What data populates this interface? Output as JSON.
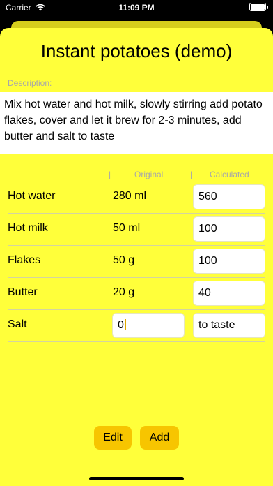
{
  "status": {
    "carrier": "Carrier",
    "time": "11:09 PM"
  },
  "title": "Instant potatoes (demo)",
  "description": {
    "label": "Description:",
    "text": "Mix hot water and hot milk, slowly stirring add potato flakes, cover and let it brew for 2-3 minutes, add butter and salt to taste"
  },
  "table": {
    "sep": "|",
    "original_header": "Original",
    "calculated_header": "Calculated",
    "rows": [
      {
        "name": "Hot water",
        "original": "280 ml",
        "calculated": "560"
      },
      {
        "name": "Hot milk",
        "original": "50 ml",
        "calculated": "100"
      },
      {
        "name": "Flakes",
        "original": "50 g",
        "calculated": "100"
      },
      {
        "name": "Butter",
        "original": "20 g",
        "calculated": "40"
      },
      {
        "name": "Salt",
        "original": "0",
        "calculated": "to taste"
      }
    ]
  },
  "buttons": {
    "edit": "Edit",
    "add": "Add"
  },
  "colors": {
    "sheet": "#ffff3a",
    "button": "#f7c500",
    "caret": "#e0a800"
  }
}
